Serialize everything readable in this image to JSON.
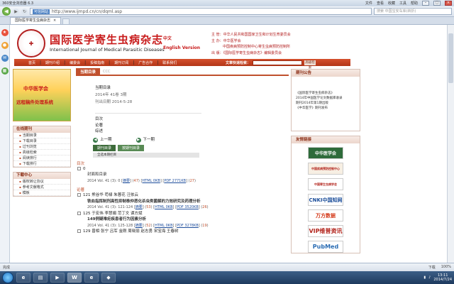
{
  "browser": {
    "title": "360安全浏览器 6.3",
    "menus": [
      "文件",
      "查看",
      "收藏",
      "工具",
      "帮助"
    ],
    "trust_badge": "可信网站",
    "url": "http://www.ijmpd.cn/cn/dqml.asp",
    "search_placeholder": "搜索 中国宝安车库(转折)",
    "tab_label": "国际医学寄生虫病杂志"
  },
  "site": {
    "cn_title": "国际医学寄生虫病杂志",
    "en_title": "International Journal of Medical Parasitic Diseases",
    "version_cn": "中文",
    "version_en": "English Version",
    "org_lines": [
      "主 管：中华人民共和国国家卫生和计划生育委员会",
      "主 办：中华医学会",
      "中国疾病预防控制中心寄生虫病预防控制所",
      "出 版：《国际医学寄生虫病杂志》编辑委员会"
    ],
    "nav": [
      "首页",
      "期刊介绍",
      "编委会",
      "投稿指南",
      "期刊订阅",
      "广告合作",
      "联系我们"
    ],
    "search_label": "文章快速检索：",
    "search_btn": "高级检索"
  },
  "left": {
    "promo_line1": "中华医学会",
    "promo_line2": "远程稿件处理系统",
    "sections": [
      {
        "title": "在线期刊",
        "items": [
          "当期目录",
          "下载目录",
          "过刊浏览",
          "高级检索",
          "阅读排行",
          "下载排行"
        ]
      },
      {
        "title": "下载中心",
        "items": [
          "版权转让协议",
          "参考文献格式",
          "模板"
        ]
      }
    ]
  },
  "main": {
    "heading": "当期目录",
    "heading_sub": "CCC",
    "issue_title": "当期目录",
    "issue_line": "2014年 41卷 3期",
    "publish_date": "刊出日期 2014-5-28",
    "toc_links": [
      "目次",
      "论著",
      "综述"
    ],
    "prev": "上一期",
    "next": "下一期",
    "tab1": "期刊目录",
    "tab2": "按期刊目录",
    "subbar": "全选本期栏目",
    "cat1": "目次",
    "articles": [
      {
        "num": "0",
        "authors": "",
        "title": "封面和目录",
        "vol": "2014 Vol. 41 (3): 0",
        "abs": "摘要",
        "abs_n": "47",
        "html": "HTML 0KB",
        "pdf": "PDF 2771KB",
        "pdf_n": "27"
      }
    ],
    "cat2": "论著",
    "articles2": [
      {
        "num": "121",
        "authors": "熊谷华 苟禄 朱蓉花 汪依云",
        "title": "铁血指挥制剂高性抑制株仲恶化杀虫类菌解的力效研究及药理分析",
        "vol": "2014 Vol. 41 (3): 121-124",
        "abs": "摘要",
        "abs_n": "53",
        "html": "HTML 0KB",
        "pdf": "PDF 3520KB",
        "pdf_n": "26"
      },
      {
        "num": "125",
        "authors": "于宏伟 李慧娟 范丁文 谭方斌",
        "title": "149例疑难疟疾患者行为因素分析",
        "vol": "2014 Vol. 41 (3): 125-128",
        "abs": "摘要",
        "abs_n": "52",
        "html": "HTML 0KB",
        "pdf": "PDF 3278KB",
        "pdf_n": "19"
      },
      {
        "num": "129",
        "authors": "曾相 张宁 吕军 金刚 周晓丽 赵志勇 宋宝海 王春树",
        "title": "",
        "vol": "",
        "abs": "",
        "abs_n": "",
        "html": "",
        "pdf": "",
        "pdf_n": ""
      }
    ]
  },
  "right": {
    "news_title": "期刊公告",
    "news_lines": [
      "《国际医学寄生虫病杂志》",
      "2014年中国医学论文数据库收录",
      "期刊2014年第1期出版",
      "《中华医学》期刊发布"
    ],
    "links_title": "友情链接",
    "links": [
      "中华医学会",
      "中国疾病预防控制中心",
      "中国寄生虫病学会",
      "CNKI中国知网",
      "万方数据",
      "VIP维普资讯",
      "PubMed"
    ]
  },
  "status": {
    "left": "完成",
    "zoom": "100%",
    "download": "下载"
  },
  "taskbar": {
    "time": "13:11",
    "date": "2014/7/24"
  }
}
